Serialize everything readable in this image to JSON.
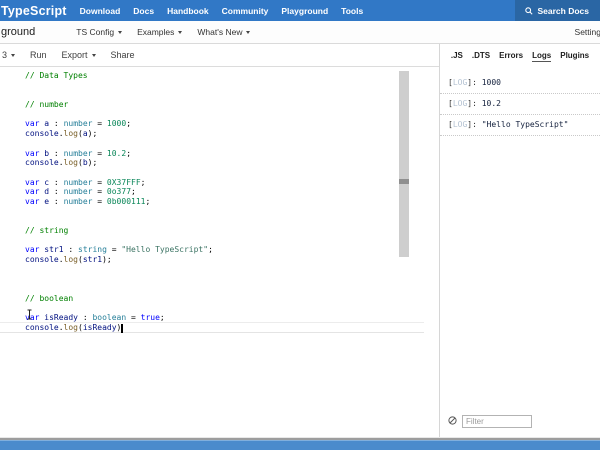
{
  "navbar": {
    "logo": "TypeScript",
    "links": [
      "Download",
      "Docs",
      "Handbook",
      "Community",
      "Playground",
      "Tools"
    ],
    "search_label": "Search Docs"
  },
  "subnav": {
    "title": "ground",
    "menus": [
      "TS Config",
      "Examples",
      "What's New"
    ],
    "settings_label": "Setting"
  },
  "toolbar": {
    "version": "3",
    "run_label": "Run",
    "export_label": "Export",
    "share_label": "Share"
  },
  "editor": {
    "lines": [
      [
        [
          "// Data Types",
          "c"
        ]
      ],
      [],
      [],
      [
        [
          "// number",
          "c"
        ]
      ],
      [],
      [
        [
          "var",
          "k"
        ],
        [
          " ",
          "d"
        ],
        [
          "a",
          "v"
        ],
        [
          " : ",
          "d"
        ],
        [
          "number",
          "t"
        ],
        [
          " = ",
          "d"
        ],
        [
          "1000",
          "n"
        ],
        [
          ";",
          "d"
        ]
      ],
      [
        [
          "console",
          "v"
        ],
        [
          ".",
          "d"
        ],
        [
          "log",
          "m"
        ],
        [
          "(",
          "d"
        ],
        [
          "a",
          "v"
        ],
        [
          ");",
          "d"
        ]
      ],
      [],
      [
        [
          "var",
          "k"
        ],
        [
          " ",
          "d"
        ],
        [
          "b",
          "v"
        ],
        [
          " : ",
          "d"
        ],
        [
          "number",
          "t"
        ],
        [
          " = ",
          "d"
        ],
        [
          "10.2",
          "n"
        ],
        [
          ";",
          "d"
        ]
      ],
      [
        [
          "console",
          "v"
        ],
        [
          ".",
          "d"
        ],
        [
          "log",
          "m"
        ],
        [
          "(",
          "d"
        ],
        [
          "b",
          "v"
        ],
        [
          ");",
          "d"
        ]
      ],
      [],
      [
        [
          "var",
          "k"
        ],
        [
          " ",
          "d"
        ],
        [
          "c",
          "v"
        ],
        [
          " : ",
          "d"
        ],
        [
          "number",
          "t"
        ],
        [
          " = ",
          "d"
        ],
        [
          "0X37FFF",
          "n"
        ],
        [
          ";",
          "d"
        ]
      ],
      [
        [
          "var",
          "k"
        ],
        [
          " ",
          "d"
        ],
        [
          "d",
          "v"
        ],
        [
          " : ",
          "d"
        ],
        [
          "number",
          "t"
        ],
        [
          " = ",
          "d"
        ],
        [
          "0o377",
          "n"
        ],
        [
          ";",
          "d"
        ]
      ],
      [
        [
          "var",
          "k"
        ],
        [
          " ",
          "d"
        ],
        [
          "e",
          "v"
        ],
        [
          " : ",
          "d"
        ],
        [
          "number",
          "t"
        ],
        [
          " = ",
          "d"
        ],
        [
          "0b000111",
          "n"
        ],
        [
          ";",
          "d"
        ]
      ],
      [],
      [],
      [
        [
          "// string",
          "c"
        ]
      ],
      [],
      [
        [
          "var",
          "k"
        ],
        [
          " ",
          "d"
        ],
        [
          "str1",
          "v"
        ],
        [
          " : ",
          "d"
        ],
        [
          "string",
          "t"
        ],
        [
          " = ",
          "d"
        ],
        [
          "\"Hello TypeScript\"",
          "s"
        ],
        [
          ";",
          "d"
        ]
      ],
      [
        [
          "console",
          "v"
        ],
        [
          ".",
          "d"
        ],
        [
          "log",
          "m"
        ],
        [
          "(",
          "d"
        ],
        [
          "str1",
          "v"
        ],
        [
          ");",
          "d"
        ]
      ],
      [],
      [],
      [],
      [
        [
          "// boolean",
          "c"
        ]
      ],
      [],
      [
        [
          "var",
          "k"
        ],
        [
          " ",
          "d"
        ],
        [
          "isReady",
          "v"
        ],
        [
          " : ",
          "d"
        ],
        [
          "boolean",
          "t"
        ],
        [
          " = ",
          "d"
        ],
        [
          "true",
          "k"
        ],
        [
          ";",
          "d"
        ]
      ],
      [
        [
          "console",
          "v"
        ],
        [
          ".",
          "d"
        ],
        [
          "log",
          "m"
        ],
        [
          "(",
          "d"
        ],
        [
          "isReady",
          "v"
        ],
        [
          ")",
          "d"
        ]
      ]
    ]
  },
  "panel": {
    "tabs": [
      ".JS",
      ".DTS",
      "Errors",
      "Logs",
      "Plugins"
    ],
    "active_tab": "Logs",
    "log_format": {
      "open": "[",
      "close": "]: "
    },
    "logs": [
      {
        "tag": "LOG",
        "value": "1000"
      },
      {
        "tag": "LOG",
        "value": "10.2"
      },
      {
        "tag": "LOG",
        "value": "\"Hello TypeScript\""
      }
    ],
    "filter_placeholder": "Filter"
  },
  "colors": {
    "navbar_blue": "#3178c6",
    "search_blue": "#2a66a4",
    "bottom_bar_blue": "#4a8bcc",
    "comment": "#008000",
    "keyword": "#0000ff",
    "variable": "#001080",
    "type": "#267f99",
    "number": "#098658",
    "string": "#3b7363",
    "method": "#795e26",
    "log_tag": "#b5c3d3"
  }
}
